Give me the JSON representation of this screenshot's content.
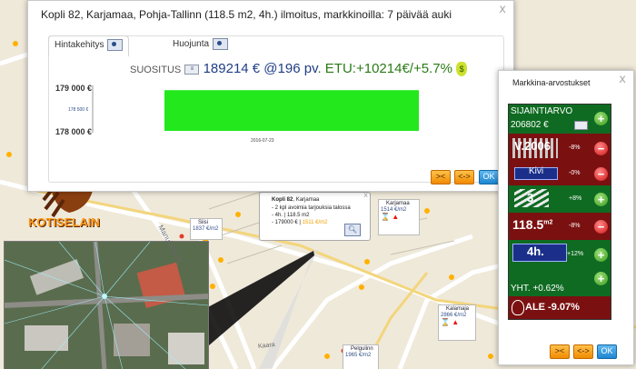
{
  "listing": {
    "title": "Kopli 82, Karjamaa, Pohja-Tallinn (118.5 m2, 4h.) ilmoitus, markkinoilla: 7 päivää auki",
    "close": "x",
    "tabs": [
      "Hintakehitys",
      "Huojunta"
    ],
    "suositus_label": "SUOSITUS",
    "price_text": "189214 € @196 pv",
    "etu_text": ". ETU:+10214€/+5.7%",
    "chart": {
      "y_labels": [
        "179 000 €",
        "178 500 €",
        "178 000 €"
      ],
      "x_label": "2016-07-23"
    },
    "buttons": {
      "prev": "><",
      "range": "<->",
      "ok": "OK"
    }
  },
  "chart_data": {
    "type": "bar",
    "categories": [
      "2016-07-23"
    ],
    "values": [
      178900
    ],
    "ylim": [
      178000,
      179000
    ],
    "ytick_labels": [
      "179 000 €",
      "178 500 €",
      "178 000 €"
    ],
    "bar_color": "#22e81c",
    "grid": false
  },
  "market": {
    "title": "Markkina-arvostukset",
    "close": "x",
    "location_label": "SIJAINTIARVO",
    "location_value": "206802 €",
    "rows": [
      {
        "label": "V.2006",
        "pct": "-8%",
        "sign": "minus"
      },
      {
        "label": "Kivi",
        "pct": "-0%",
        "sign": "minus"
      },
      {
        "label": "3.",
        "pct": "+8%",
        "sign": "plus"
      },
      {
        "label": "118.5",
        "sup": "m2",
        "pct": "-8%",
        "sign": "minus"
      },
      {
        "label": "4h.",
        "pct": "+12%",
        "sign": "plus"
      }
    ],
    "total": "YHT. +0.62%",
    "ale": "ALE -9.07%",
    "buttons": {
      "prev": "><",
      "range": "<->",
      "ok": "OK"
    }
  },
  "popup": {
    "close": "x",
    "title": "Kopli 82",
    "district": "Karjamaa",
    "lines": [
      "- 2 kpl avoimia tarjouksia talossa",
      "- 4h. | 118.5 m2"
    ],
    "price_line_start": "- 179000 € | ",
    "price_line_value": "1511 €/m2"
  },
  "map_tags": [
    {
      "name": "Siisi",
      "value": "1837 €/m2"
    },
    {
      "name": "Karjamaa",
      "value": "1514 €/m2"
    },
    {
      "name": "Kalamaja",
      "value": "2866 €/m2"
    },
    {
      "name": "Pelgulinn",
      "value": "1965 €/m2"
    }
  ],
  "logo_text": "KOTISELAIN",
  "map_labels": [
    "Manufaktuuri",
    "Kaara"
  ],
  "colors": {
    "market_bg": "#7b1010",
    "market_green": "#0f6b22",
    "bar": "#22e81c",
    "price_blue": "#1f3d86"
  }
}
